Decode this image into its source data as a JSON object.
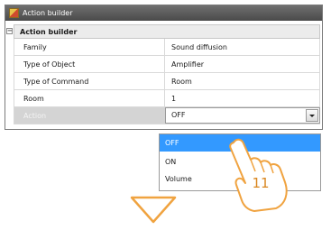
{
  "window": {
    "title": "Action builder"
  },
  "section": {
    "label": "Action builder"
  },
  "properties": [
    {
      "name": "Family",
      "value": "Sound diffusion"
    },
    {
      "name": "Type of Object",
      "value": "Amplifier"
    },
    {
      "name": "Type of Command",
      "value": "Room"
    },
    {
      "name": "Room",
      "value": "1"
    }
  ],
  "action": {
    "name": "Action",
    "value": "OFF"
  },
  "dropdown": {
    "options": [
      "OFF",
      "ON",
      "Volume"
    ],
    "selected": "OFF"
  },
  "annotation": {
    "step": "11"
  },
  "colors": {
    "highlight": "#3399ff",
    "callout": "#f0a340"
  }
}
